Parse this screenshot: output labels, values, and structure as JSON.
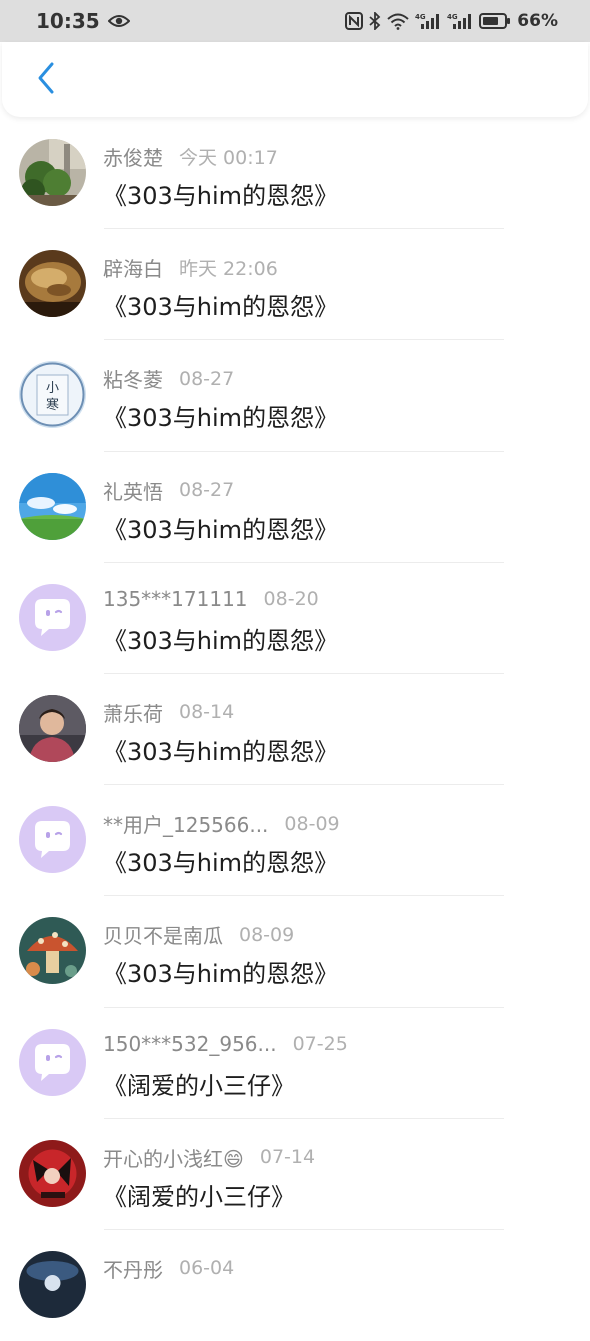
{
  "status_bar": {
    "time": "10:35",
    "battery": "66%",
    "icons": [
      "eye-icon",
      "nfc-icon",
      "bluetooth-icon",
      "wifi-icon",
      "signal-4g-icon",
      "signal-4g-icon",
      "battery-icon"
    ]
  },
  "header": {
    "back_icon": "chevron-left-icon",
    "accent": "#2a8fe0"
  },
  "items": [
    {
      "name": "赤俊楚",
      "time": "今天 00:17",
      "title": "《303与him的恩怨》",
      "avatar": "photo-plant"
    },
    {
      "name": "辟海白",
      "time": "昨天 22:06",
      "title": "《303与him的恩怨》",
      "avatar": "photo-food"
    },
    {
      "name": "粘冬菱",
      "time": "08-27",
      "title": "《303与him的恩怨》",
      "avatar": "photo-snow-art",
      "avatar_text": "小寒"
    },
    {
      "name": "礼英悟",
      "time": "08-27",
      "title": "《303与him的恩怨》",
      "avatar": "photo-sky"
    },
    {
      "name": "135***171111",
      "time": "08-20",
      "title": "《303与him的恩怨》",
      "avatar": "default-chat-avatar"
    },
    {
      "name": "萧乐荷",
      "time": "08-14",
      "title": "《303与him的恩怨》",
      "avatar": "photo-person"
    },
    {
      "name": "**用户_125566...",
      "time": "08-09",
      "title": "《303与him的恩怨》",
      "avatar": "default-chat-avatar"
    },
    {
      "name": "贝贝不是南瓜",
      "time": "08-09",
      "title": "《303与him的恩怨》",
      "avatar": "photo-mushroom"
    },
    {
      "name": "150***532_956...",
      "time": "07-25",
      "title": "《阔爱的小三仔》",
      "avatar": "default-chat-avatar"
    },
    {
      "name": "开心的小浅红😄",
      "time": "07-14",
      "title": "《阔爱的小三仔》",
      "avatar": "photo-red-art"
    },
    {
      "name": "不丹彤",
      "time": "06-04",
      "title": "",
      "avatar": "photo-dark"
    }
  ]
}
